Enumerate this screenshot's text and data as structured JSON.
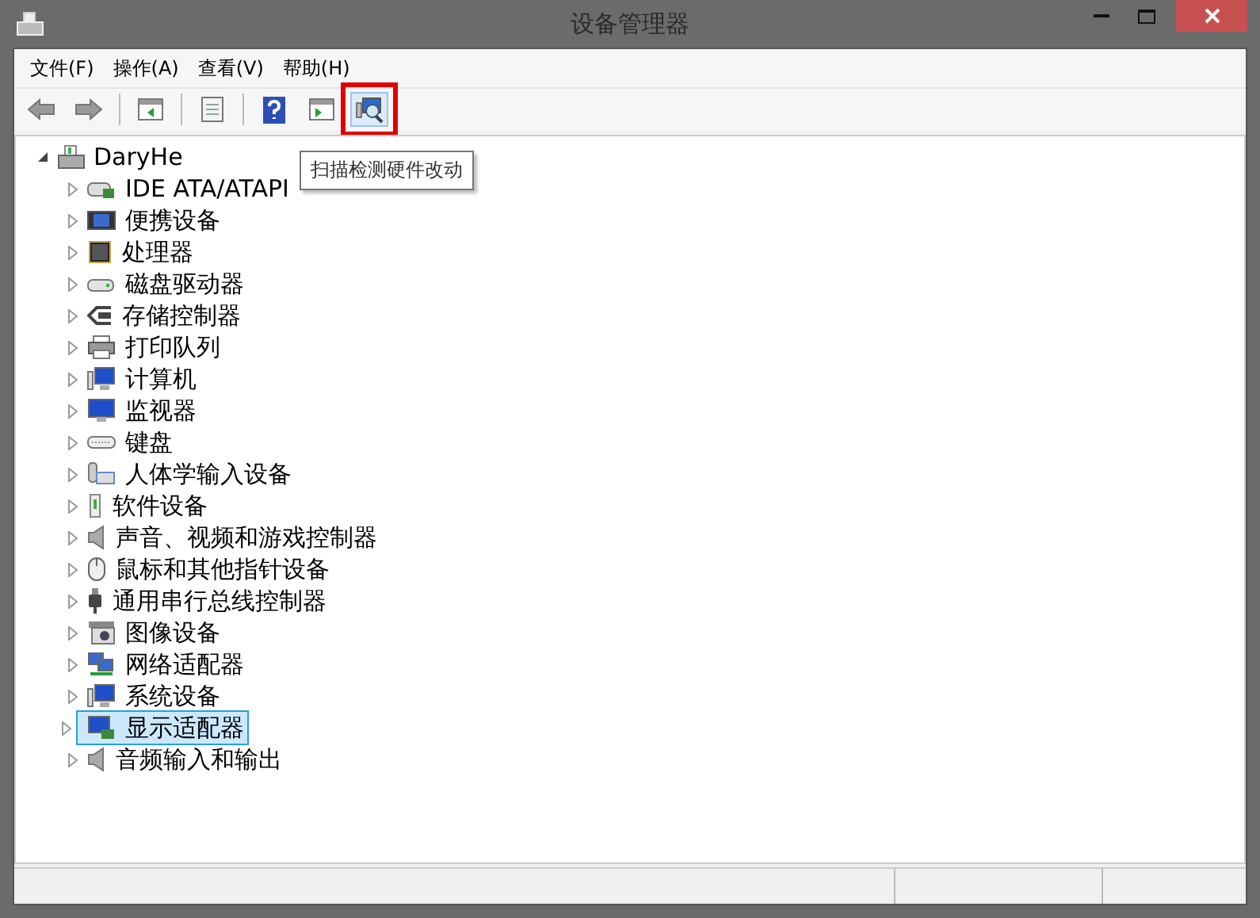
{
  "window": {
    "title": "设备管理器"
  },
  "menu": [
    {
      "label": "文件(F)"
    },
    {
      "label": "操作(A)"
    },
    {
      "label": "查看(V)"
    },
    {
      "label": "帮助(H)"
    }
  ],
  "toolbar": [
    {
      "kind": "back",
      "hover": false,
      "marked": false
    },
    {
      "kind": "forward",
      "hover": false,
      "marked": false
    },
    {
      "kind": "separator"
    },
    {
      "kind": "tree-pane",
      "hover": false,
      "marked": false
    },
    {
      "kind": "separator"
    },
    {
      "kind": "properties",
      "hover": false,
      "marked": false
    },
    {
      "kind": "separator"
    },
    {
      "kind": "help",
      "hover": false,
      "marked": false
    },
    {
      "kind": "action-pane",
      "hover": false,
      "marked": false
    },
    {
      "kind": "scan",
      "hover": true,
      "marked": true
    }
  ],
  "tooltip": {
    "text": "扫描检测硬件改动"
  },
  "tree": {
    "label": "DaryHe",
    "expanded": true,
    "children": [
      {
        "label": "IDE ATA/ATAPI",
        "kind": "drive",
        "expanded": false,
        "selected": false
      },
      {
        "label": "便携设备",
        "kind": "portable",
        "expanded": false,
        "selected": false
      },
      {
        "label": "处理器",
        "kind": "cpu",
        "expanded": false,
        "selected": false
      },
      {
        "label": "磁盘驱动器",
        "kind": "disk",
        "expanded": false,
        "selected": false
      },
      {
        "label": "存储控制器",
        "kind": "storage",
        "expanded": false,
        "selected": false
      },
      {
        "label": "打印队列",
        "kind": "printer",
        "expanded": false,
        "selected": false
      },
      {
        "label": "计算机",
        "kind": "computer",
        "expanded": false,
        "selected": false
      },
      {
        "label": "监视器",
        "kind": "monitor",
        "expanded": false,
        "selected": false
      },
      {
        "label": "键盘",
        "kind": "keyboard",
        "expanded": false,
        "selected": false
      },
      {
        "label": "人体学输入设备",
        "kind": "hid",
        "expanded": false,
        "selected": false
      },
      {
        "label": "软件设备",
        "kind": "software",
        "expanded": false,
        "selected": false
      },
      {
        "label": "声音、视频和游戏控制器",
        "kind": "speaker",
        "expanded": false,
        "selected": false
      },
      {
        "label": "鼠标和其他指针设备",
        "kind": "mouse",
        "expanded": false,
        "selected": false
      },
      {
        "label": "通用串行总线控制器",
        "kind": "usb",
        "expanded": false,
        "selected": false
      },
      {
        "label": "图像设备",
        "kind": "camera",
        "expanded": false,
        "selected": false
      },
      {
        "label": "网络适配器",
        "kind": "network",
        "expanded": false,
        "selected": false
      },
      {
        "label": "系统设备",
        "kind": "computer",
        "expanded": false,
        "selected": false
      },
      {
        "label": "显示适配器",
        "kind": "display",
        "expanded": false,
        "selected": true
      },
      {
        "label": "音频输入和输出",
        "kind": "speaker",
        "expanded": false,
        "selected": false
      }
    ]
  }
}
